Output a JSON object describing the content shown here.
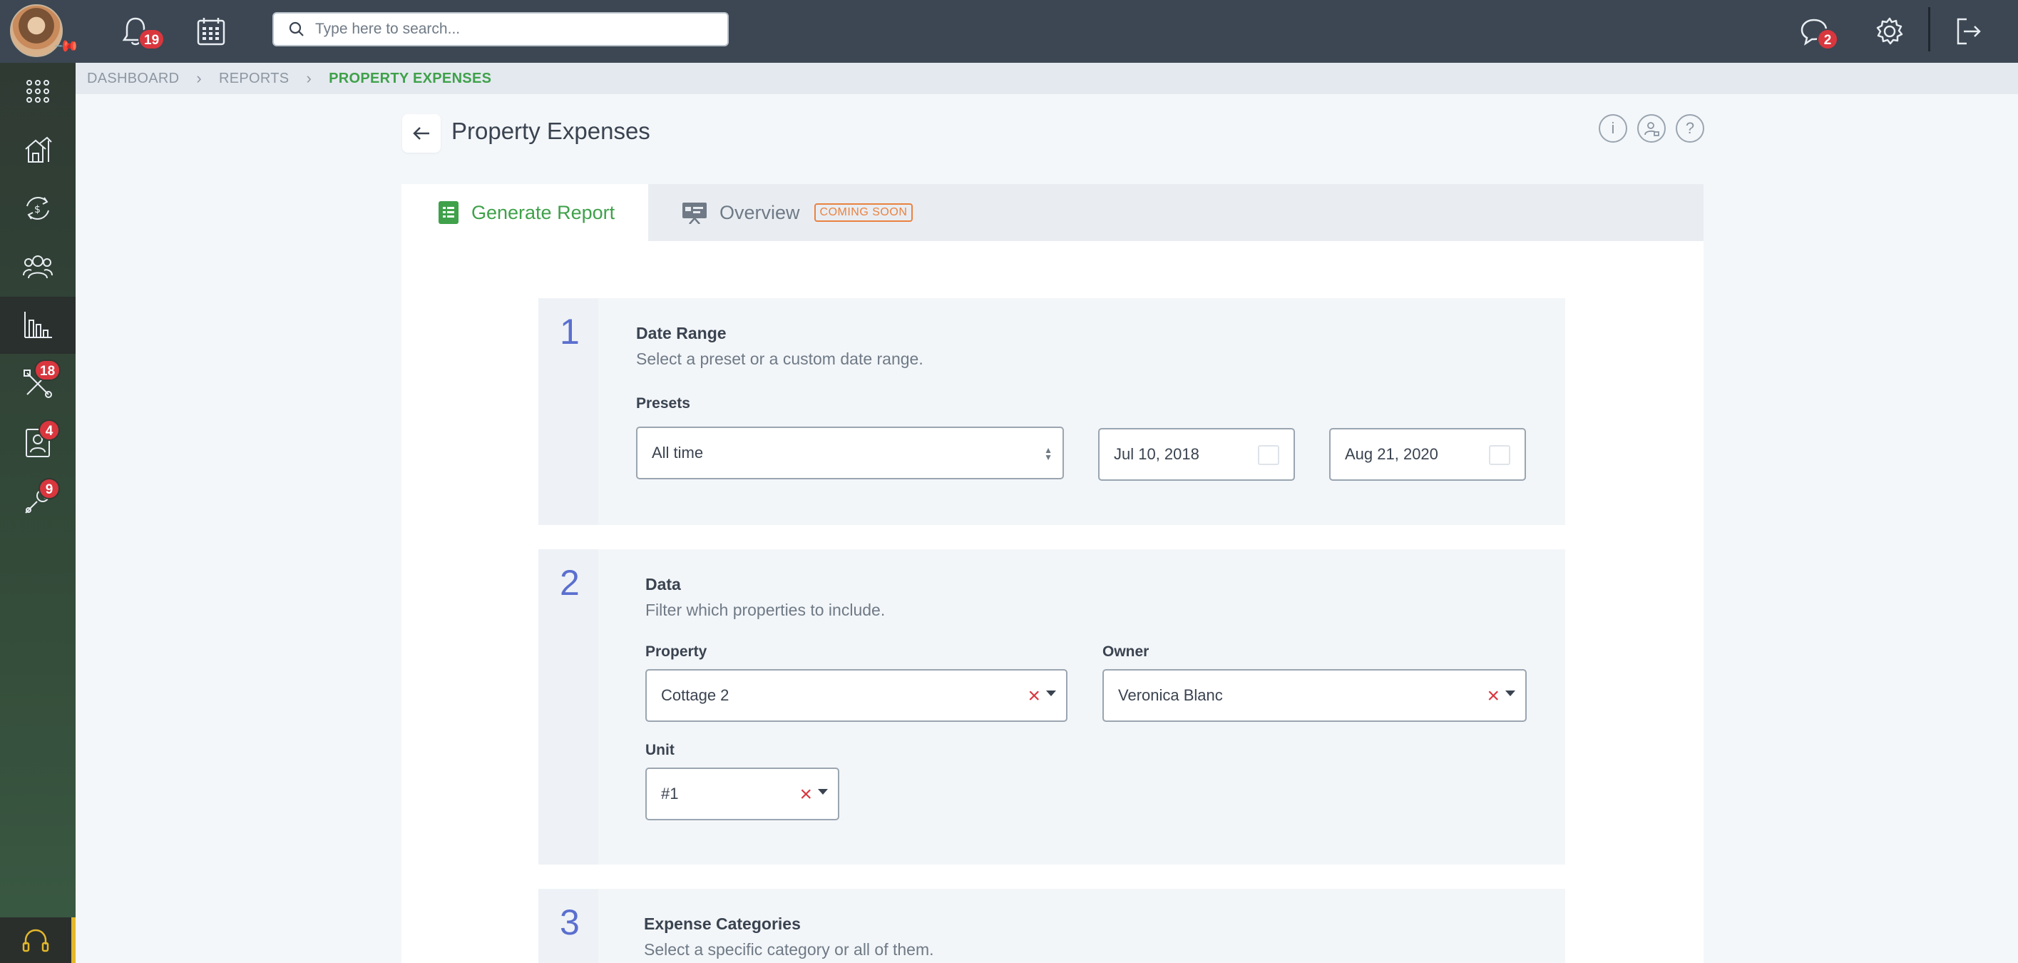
{
  "topbar": {
    "search_placeholder": "Type here to search...",
    "notifications_count": "19",
    "messages_count": "2"
  },
  "sidebar": {
    "items": [
      {
        "icon": "apps-grid-icon",
        "badge": ""
      },
      {
        "icon": "properties-icon",
        "badge": ""
      },
      {
        "icon": "accounting-icon",
        "badge": ""
      },
      {
        "icon": "people-icon",
        "badge": ""
      },
      {
        "icon": "reports-icon",
        "badge": "",
        "active": true
      },
      {
        "icon": "tasks-icon",
        "badge": "18"
      },
      {
        "icon": "applicants-icon",
        "badge": "4"
      },
      {
        "icon": "maintenance-icon",
        "badge": "9"
      }
    ]
  },
  "breadcrumb": {
    "items": [
      "DASHBOARD",
      "REPORTS",
      "PROPERTY EXPENSES"
    ]
  },
  "page": {
    "title": "Property Expenses"
  },
  "tabs": {
    "generate": "Generate Report",
    "overview": "Overview",
    "coming_soon": "COMING SOON"
  },
  "sections": {
    "date_range": {
      "number": "1",
      "title": "Date Range",
      "description": "Select a preset or a custom date range.",
      "presets_label": "Presets",
      "preset_value": "All time",
      "start_date": "Jul 10, 2018",
      "end_date": "Aug 21, 2020"
    },
    "data": {
      "number": "2",
      "title": "Data",
      "description": "Filter which properties to include.",
      "property_label": "Property",
      "property_value": "Cottage 2",
      "owner_label": "Owner",
      "owner_value": "Veronica Blanc",
      "unit_label": "Unit",
      "unit_value": "#1"
    },
    "expense_categories": {
      "number": "3",
      "title": "Expense Categories",
      "description": "Select a specific category or all of them."
    }
  },
  "colors": {
    "topbar": "#3c4753",
    "accent_green": "#3fa14a",
    "step_blue": "#5b6fcf",
    "badge_red": "#d9363e",
    "coming_soon_orange": "#e98240"
  }
}
